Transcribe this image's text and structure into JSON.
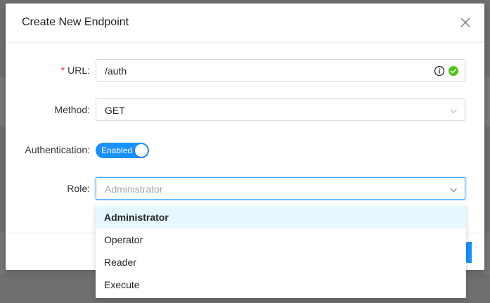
{
  "modal": {
    "title": "Create New Endpoint"
  },
  "form": {
    "url": {
      "required_mark": "*",
      "label": "URL:",
      "value": "/auth",
      "status_icons": [
        "info-icon",
        "check-circle-icon"
      ]
    },
    "method": {
      "label": "Method:",
      "value": "GET"
    },
    "authentication": {
      "label": "Authentication:",
      "switch_text": "Enabled",
      "on": true
    },
    "role": {
      "label": "Role:",
      "placeholder": "Administrator"
    }
  },
  "role_dropdown": {
    "options": [
      "Administrator",
      "Operator",
      "Reader",
      "Execute"
    ],
    "selected": "Administrator"
  },
  "colors": {
    "primary": "#1890ff",
    "success": "#52c41a",
    "required": "#f5222d",
    "selected_option_bg": "#e6f7ff"
  }
}
